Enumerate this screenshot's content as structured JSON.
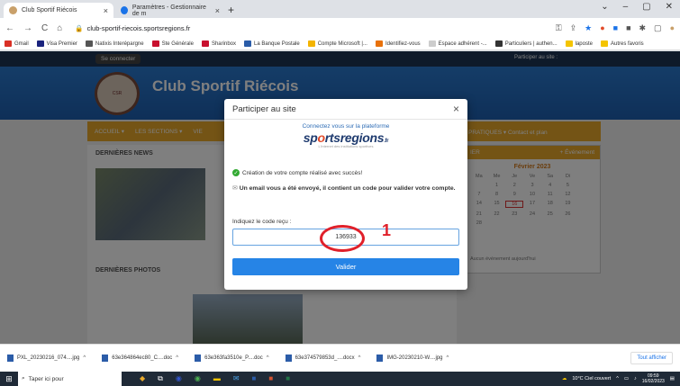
{
  "browser": {
    "tabs": [
      {
        "title": "Club Sportif Riécois",
        "close": "×"
      },
      {
        "title": "Paramètres - Gestionnaire de m",
        "close": "×"
      }
    ],
    "new_tab": "+",
    "window_controls": [
      "⌄",
      "–",
      "▢",
      "✕"
    ],
    "url": "club-sportif-riecois.sportsregions.fr",
    "nav": {
      "back": "←",
      "forward": "→",
      "reload": "C",
      "home": "⌂"
    },
    "bookmarks": [
      "Gmail",
      "Visa Premier",
      "Natixis Interépargne",
      "Ste Générale",
      "Sharinbox",
      "La Banque Postale",
      "Compte Microsoft |...",
      "Identifiez-vous",
      "Espace adhérent -...",
      "Particuliers | authen...",
      "laposte",
      "Autres favoris"
    ]
  },
  "site": {
    "connect": "Se connecter",
    "participer_top": "Participer au site :",
    "title": "Club Sportif Riécois",
    "nav_items": [
      "ACCUEIL ▾",
      "LES SECTIONS ▾",
      "VIE"
    ],
    "nav_right": "PRATIQUES ▾    Contact et plan",
    "news_title": "DERNIÈRES NEWS",
    "photos_title": "DERNIÈRES PHOTOS",
    "agenda": {
      "title": "IER",
      "link": "+ Événement",
      "month": "Février 2023",
      "days": [
        "Ma",
        "Me",
        "Je",
        "Ve",
        "Sa",
        "Di",
        ""
      ],
      "dates": [
        "",
        "1",
        "2",
        "3",
        "4",
        "5",
        "",
        "7",
        "8",
        "9",
        "10",
        "11",
        "12",
        "",
        "14",
        "15",
        "16",
        "17",
        "18",
        "19",
        "",
        "21",
        "22",
        "23",
        "24",
        "25",
        "26",
        "",
        "28"
      ],
      "today": "16",
      "empty": "Aucun événement aujourd'hui"
    }
  },
  "modal": {
    "title": "Participer au site",
    "close": "×",
    "brand_line": "Connectez vous sur la plateforme",
    "brand": {
      "a": "sp",
      "o": "o",
      "b": "rtsregions",
      "fr": ".fr"
    },
    "brand_tag": "L'internet des institutions sportives",
    "success": "Création de votre compte réalisé avec succès!",
    "email_msg": "Un email vous a été envoyé, il contient un code pour valider votre compte.",
    "code_label": "Indiquez le code reçu :",
    "code_value": "136933",
    "validate": "Valider"
  },
  "annotation": {
    "number": "1",
    "color": "#e0202a"
  },
  "downloads": {
    "items": [
      "PXL_20230216_074....jpg",
      "63e364864ec80_C....doc",
      "63e363fa3510e_P....doc",
      "63e374579853d_....docx",
      "IMG-20230210-W....jpg"
    ],
    "show_all": "Tout afficher"
  },
  "taskbar": {
    "search": "Taper ici pour",
    "weather": "10°C  Ciel couvert",
    "time": "09:59",
    "date": "16/02/2023"
  }
}
